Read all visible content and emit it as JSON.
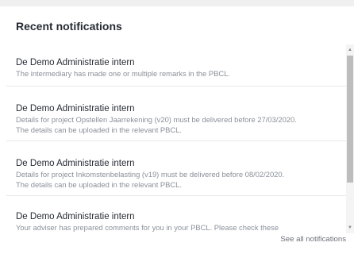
{
  "panel": {
    "title": "Recent notifications"
  },
  "notifications": [
    {
      "title": "De Demo Administratie intern",
      "lines": [
        "The intermediary has made one or multiple remarks in the PBCL."
      ]
    },
    {
      "title": "De Demo Administratie intern",
      "lines": [
        "Details for project Opstellen Jaarrekening (v20) must be delivered before 27/03/2020.",
        "The details can be uploaded in the relevant PBCL."
      ]
    },
    {
      "title": "De Demo Administratie intern",
      "lines": [
        "Details for project Inkomstenbelasting (v19) must be delivered before 08/02/2020.",
        "The details can be uploaded in the relevant PBCL."
      ]
    },
    {
      "title": "De Demo Administratie intern",
      "lines": [
        "Your adviser has prepared comments for you in your PBCL. Please check these"
      ]
    }
  ],
  "footer": {
    "see_all_label": "See all notifications"
  },
  "icons": {
    "scroll_up": "chevron-up-icon",
    "scroll_down": "chevron-down-icon"
  }
}
